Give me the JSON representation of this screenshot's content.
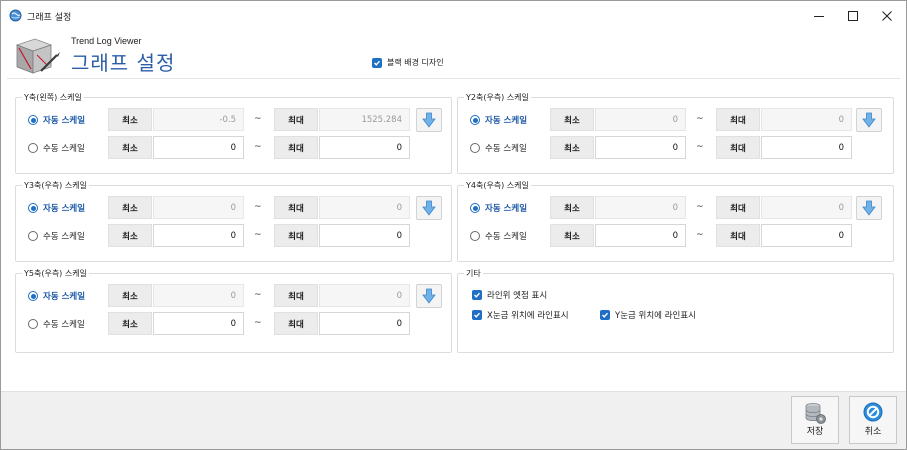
{
  "window": {
    "title": "그래프 설정"
  },
  "header": {
    "app_name": "Trend Log Viewer",
    "title": "그래프 설정",
    "dark_background_label": "블랙 배경 디자인",
    "dark_background_checked": true
  },
  "common": {
    "auto_scale": "자동 스케일",
    "manual_scale": "수동 스케일",
    "min": "최소",
    "max": "최대",
    "tilde": "~"
  },
  "axes": {
    "y1": {
      "label": "Y축(왼쪽) 스케일",
      "auto_min": "-0.5",
      "auto_max": "1525.284",
      "manual_min": "0",
      "manual_max": "0",
      "mode": "auto"
    },
    "y2": {
      "label": "Y2축(우측) 스케일",
      "auto_min": "0",
      "auto_max": "0",
      "manual_min": "0",
      "manual_max": "0",
      "mode": "auto"
    },
    "y3": {
      "label": "Y3축(우측) 스케일",
      "auto_min": "0",
      "auto_max": "0",
      "manual_min": "0",
      "manual_max": "0",
      "mode": "auto"
    },
    "y4": {
      "label": "Y4축(우측) 스케일",
      "auto_min": "0",
      "auto_max": "0",
      "manual_min": "0",
      "manual_max": "0",
      "mode": "auto"
    },
    "y5": {
      "label": "Y5축(우측) 스케일",
      "auto_min": "0",
      "auto_max": "0",
      "manual_min": "0",
      "manual_max": "0",
      "mode": "auto"
    }
  },
  "misc": {
    "label": "기타",
    "items": [
      {
        "label": "라인위 엣점 표시",
        "checked": true
      },
      {
        "label": "X눈금 위치에 라인표시",
        "checked": true
      },
      {
        "label": "Y눈금 위치에 라인표시",
        "checked": true
      }
    ]
  },
  "footer": {
    "save_label": "저장",
    "cancel_label": "취소"
  },
  "colors": {
    "accent": "#1f6fc6",
    "title_blue": "#2a5ea8",
    "footer_bg": "#f0f0f0"
  }
}
